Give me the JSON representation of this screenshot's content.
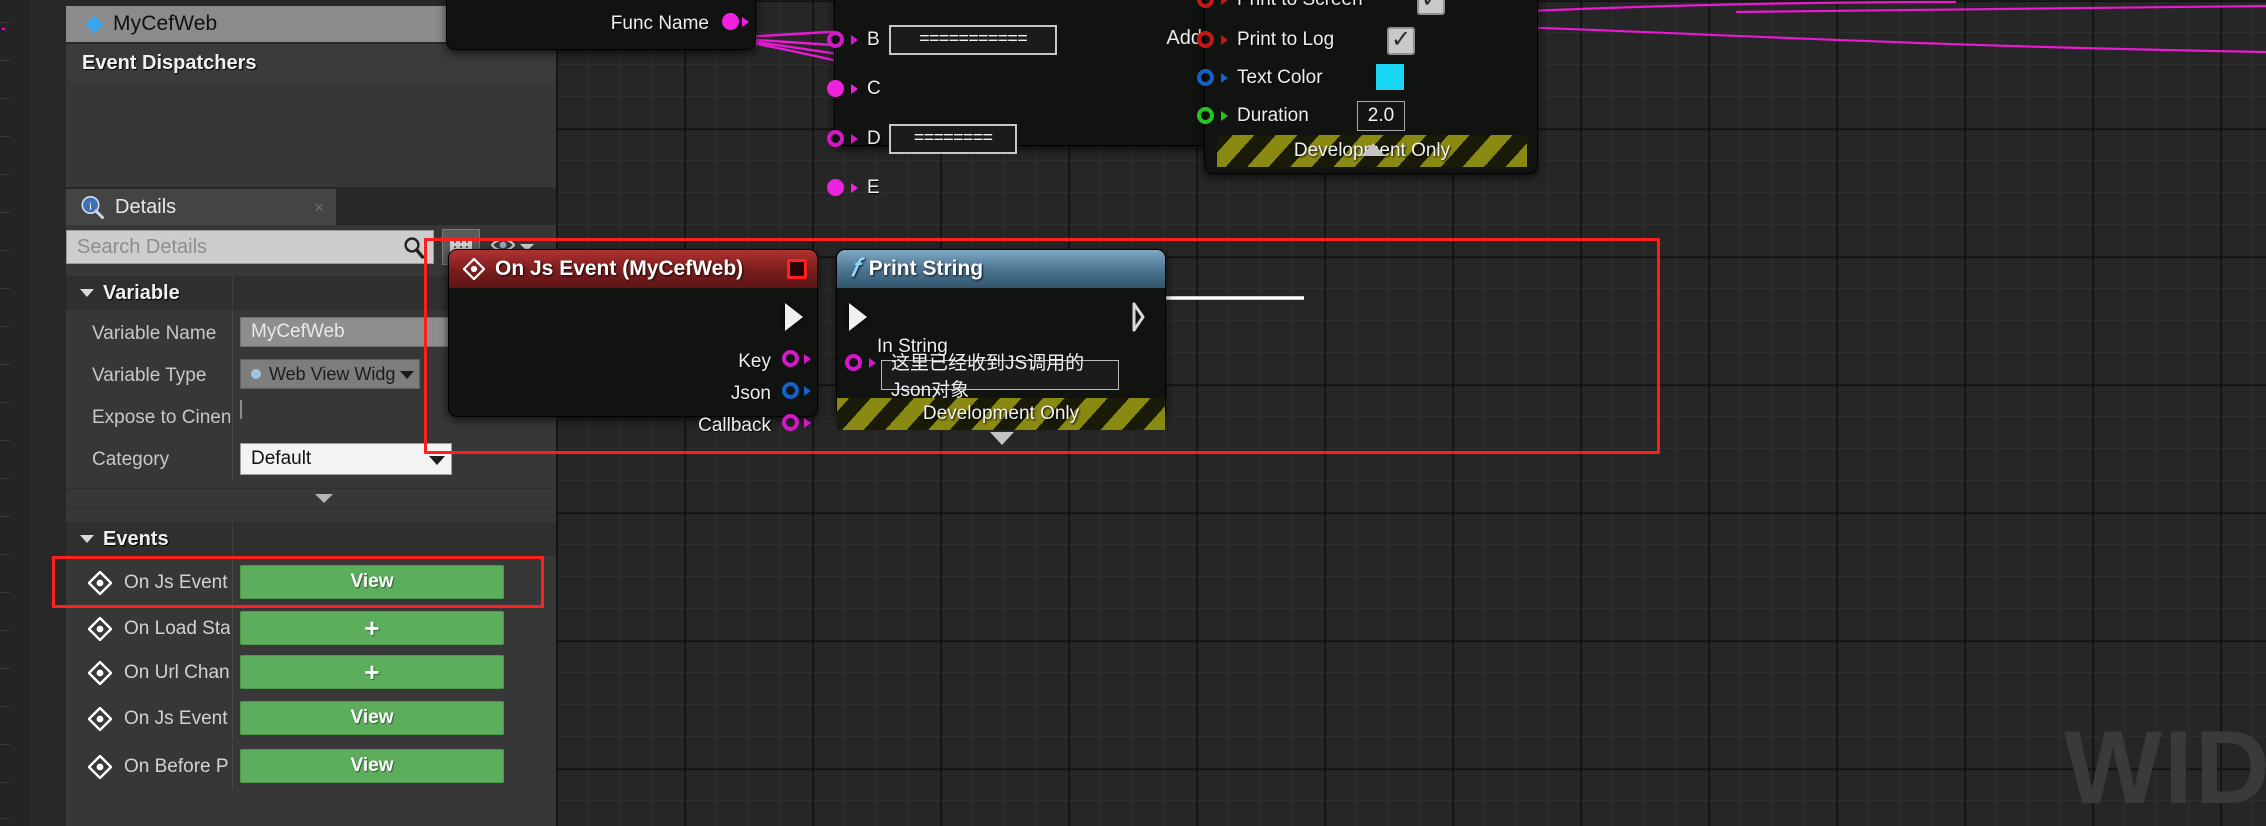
{
  "app": {
    "watermark": "WID"
  },
  "left_panel": {
    "variable_header": {
      "name": "MyCefWeb",
      "icon": "variable-diamond-icon",
      "eye_icon": "eye-visibility-icon"
    },
    "event_dispatchers": {
      "title": "Event Dispatchers",
      "add_label": "+"
    },
    "details_tab": {
      "label": "Details",
      "icon": "details-info-icon",
      "close": "×"
    },
    "search": {
      "placeholder": "Search Details",
      "icon": "search-icon",
      "grid_icon": "grid-view-icon",
      "eye_icon": "eye-filter-icon"
    },
    "variable_section": {
      "title": "Variable",
      "rows": [
        {
          "label": "Variable Name",
          "value": "MyCefWeb",
          "kind": "text"
        },
        {
          "label": "Variable Type",
          "value": "Web View Widg",
          "kind": "combo-dark"
        },
        {
          "label": "Expose to Cinen",
          "value": "",
          "kind": "checkbox"
        },
        {
          "label": "Category",
          "value": "Default",
          "kind": "combo-light"
        }
      ]
    },
    "events_section": {
      "title": "Events",
      "rows": [
        {
          "label": "On Js Event",
          "button": "View",
          "highlighted": true
        },
        {
          "label": "On Load Sta",
          "button": "+",
          "highlighted": false
        },
        {
          "label": "On Url Chan",
          "button": "+",
          "highlighted": false
        },
        {
          "label": "On Js Event",
          "button": "View",
          "highlighted": false
        },
        {
          "label": "On Before P",
          "button": "View",
          "highlighted": false
        }
      ]
    }
  },
  "graph": {
    "nodes": {
      "func_name_node": {
        "pin_label": "Func Name"
      },
      "multi_pin_node": {
        "add_pin_label": "Add pin",
        "pins": [
          {
            "label": "B",
            "value": "==========="
          },
          {
            "label": "C",
            "value": ""
          },
          {
            "label": "D",
            "value": "========"
          },
          {
            "label": "E",
            "value": ""
          }
        ]
      },
      "print_to_screen_node": {
        "rows": [
          {
            "label": "Print to Screen",
            "kind": "checkbox",
            "value": "☑"
          },
          {
            "label": "Print to Log",
            "kind": "checkbox",
            "value": "☑"
          },
          {
            "label": "Text Color",
            "kind": "color",
            "value": "#1ad6f5"
          },
          {
            "label": "Duration",
            "kind": "number",
            "value": "2.0"
          }
        ],
        "dev_only": "Development Only"
      },
      "on_js_event_node": {
        "title": "On Js Event (MyCefWeb)",
        "pins": [
          {
            "label": "Key",
            "color": "#d418c8"
          },
          {
            "label": "Json",
            "color": "#1461c8"
          },
          {
            "label": "Callback",
            "color": "#d418c8"
          }
        ]
      },
      "print_string_node": {
        "title": "Print String",
        "in_string_label": "In String",
        "in_string_value": "这里已经收到JS调用的Json对象",
        "dev_only": "Development Only"
      }
    },
    "colors": {
      "selection": "#ff1d1d",
      "exec_wire": "#ffffff",
      "data_wire": "#e81ad2",
      "event_title": "#7a1d1d",
      "function_title": "#4a7290"
    }
  }
}
